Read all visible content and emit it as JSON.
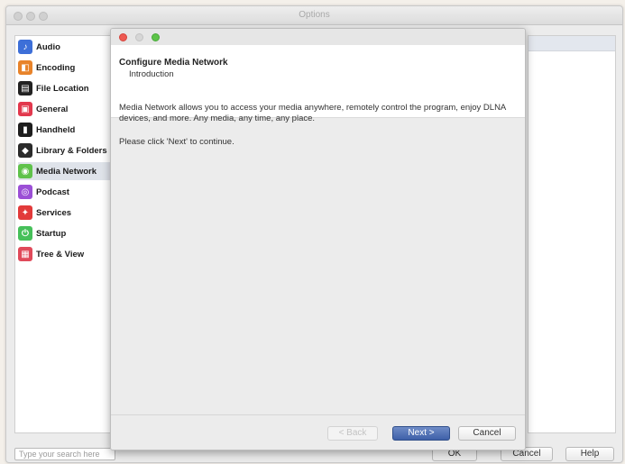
{
  "window": {
    "title": "Options"
  },
  "sidebar": {
    "items": [
      {
        "label": "Audio",
        "icon": "audio-icon",
        "color": "#3d6fd8",
        "glyph": "♪"
      },
      {
        "label": "Encoding",
        "icon": "encoding-icon",
        "color": "#e8832a",
        "glyph": "◧"
      },
      {
        "label": "File Location",
        "icon": "file-location-icon",
        "color": "#222222",
        "glyph": "▤"
      },
      {
        "label": "General",
        "icon": "general-icon",
        "color": "#e2384d",
        "glyph": "▣"
      },
      {
        "label": "Handheld",
        "icon": "handheld-icon",
        "color": "#1e1e1e",
        "glyph": "▮"
      },
      {
        "label": "Library & Folders",
        "icon": "library-icon",
        "color": "#2b2b2b",
        "glyph": "◆"
      },
      {
        "label": "Media Network",
        "icon": "media-network-icon",
        "color": "#5fc24a",
        "glyph": "◉"
      },
      {
        "label": "Podcast",
        "icon": "podcast-icon",
        "color": "#9b4fd6",
        "glyph": "◎"
      },
      {
        "label": "Services",
        "icon": "services-icon",
        "color": "#e23a3a",
        "glyph": "✦"
      },
      {
        "label": "Startup",
        "icon": "startup-icon",
        "color": "#46c05a",
        "glyph": "⏻"
      },
      {
        "label": "Tree & View",
        "icon": "tree-view-icon",
        "color": "#e04a5a",
        "glyph": "▦"
      }
    ],
    "selected": "Media Network"
  },
  "search": {
    "placeholder": "Type your search here"
  },
  "footer": {
    "ok_label": "OK",
    "cancel_label": "Cancel",
    "help_label": "Help"
  },
  "wizard": {
    "title": "Configure Media Network",
    "subtitle": "Introduction",
    "body_1": "Media Network allows you to access your media anywhere, remotely control the program, enjoy DLNA devices, and more.  Any media, any time, any place.",
    "body_2": "Please click 'Next' to continue.",
    "back_label": "< Back",
    "next_label": "Next >",
    "cancel_label": "Cancel"
  }
}
